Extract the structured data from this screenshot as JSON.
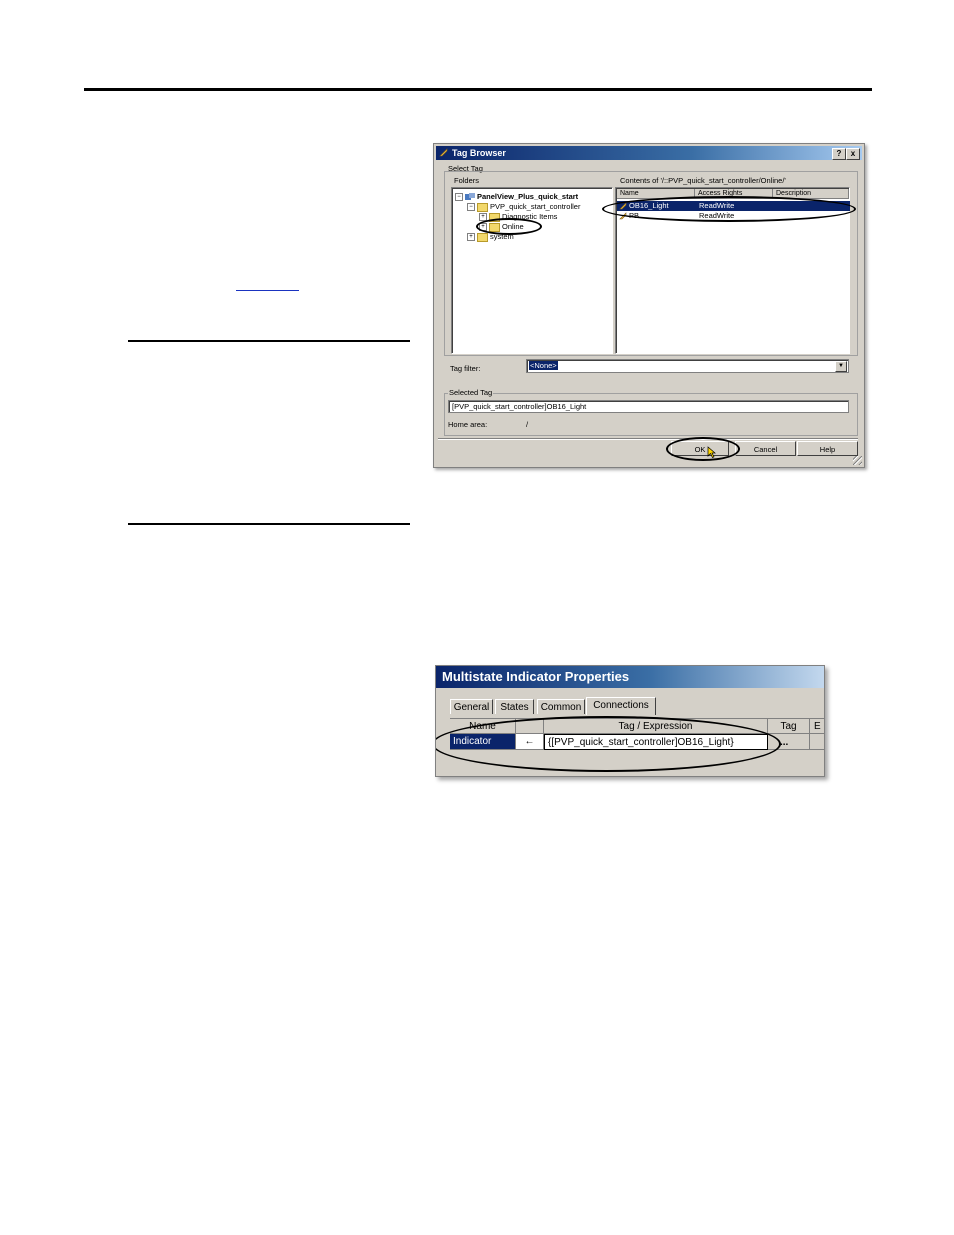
{
  "page": {
    "link_text": ""
  },
  "tag_browser": {
    "title": "Tag Browser",
    "help_btn": "?",
    "close_btn": "x",
    "select_tag_label": "Select Tag",
    "folders_label": "Folders",
    "tree": [
      {
        "label": "PanelView_Plus_quick_start",
        "expander": "−"
      },
      {
        "label": "PVP_quick_start_controller",
        "expander": "−"
      },
      {
        "label": "Diagnostic Items",
        "expander": "+"
      },
      {
        "label": "Online",
        "expander": "+"
      },
      {
        "label": "system",
        "expander": "+"
      }
    ],
    "contents_label": "Contents of '/::PVP_quick_start_controller/Online/'",
    "columns": [
      "Name",
      "Access Rights",
      "Description"
    ],
    "rows": [
      {
        "name": "OB16_Light",
        "access": "ReadWrite",
        "description": "",
        "selected": true
      },
      {
        "name": "PB",
        "access": "ReadWrite",
        "description": "",
        "selected": false
      }
    ],
    "tag_filter_label": "Tag filter:",
    "tag_filter_value": "<None>",
    "selected_tag_label": "Selected Tag",
    "selected_tag_value": "[PVP_quick_start_controller]OB16_Light",
    "home_area_label": "Home area:",
    "home_area_value": "/",
    "ok_label": "OK",
    "cancel_label": "Cancel",
    "help_label": "Help"
  },
  "multistate": {
    "title": "Multistate Indicator Properties",
    "tabs": [
      "General",
      "States",
      "Common",
      "Connections"
    ],
    "active_tab": "Connections",
    "columns": [
      "Name",
      "",
      "Tag / Expression",
      "Tag",
      "E"
    ],
    "row": {
      "name": "Indicator",
      "direction": "←",
      "expression": "{[PVP_quick_start_controller]OB16_Light}",
      "tag_btn": "..."
    }
  }
}
